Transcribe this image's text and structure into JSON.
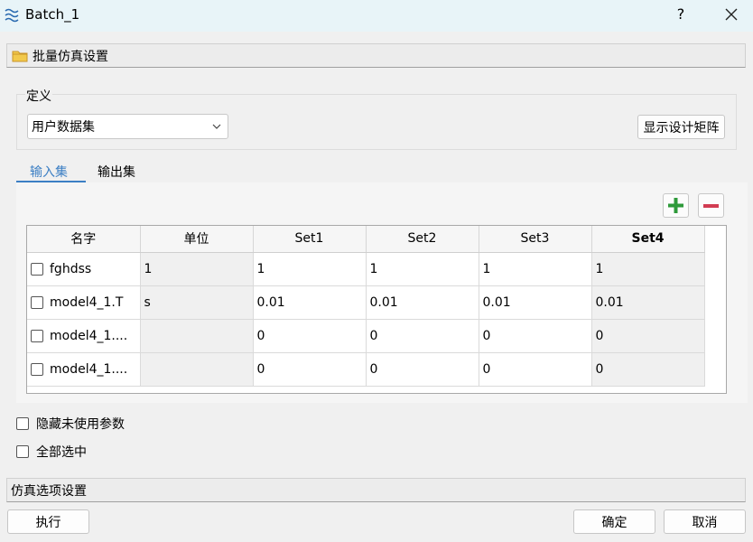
{
  "window": {
    "title": "Batch_1",
    "help": "?"
  },
  "batch_section": {
    "label": "批量仿真设置"
  },
  "definition": {
    "group_title": "定义",
    "dataset_select": {
      "value": "用户数据集"
    },
    "show_matrix_label": "显示设计矩阵"
  },
  "tabs": [
    {
      "label": "输入集"
    },
    {
      "label": "输出集"
    }
  ],
  "table": {
    "headers": [
      "名字",
      "单位",
      "Set1",
      "Set2",
      "Set3",
      "Set4"
    ],
    "rows": [
      {
        "name": "fghdss",
        "unit": "1",
        "values": [
          "1",
          "1",
          "1",
          "1"
        ]
      },
      {
        "name": "model4_1.T",
        "unit": "s",
        "values": [
          "0.01",
          "0.01",
          "0.01",
          "0.01"
        ]
      },
      {
        "name": "model4_1....",
        "unit": "",
        "values": [
          "0",
          "0",
          "0",
          "0"
        ]
      },
      {
        "name": "model4_1....",
        "unit": "",
        "values": [
          "0",
          "0",
          "0",
          "0"
        ]
      }
    ]
  },
  "options": {
    "hide_unused": "隐藏未使用参数",
    "select_all": "全部选中"
  },
  "sim_section": {
    "label": "仿真选项设置"
  },
  "buttons": {
    "run": "执行",
    "ok": "确定",
    "cancel": "取消"
  },
  "colors": {
    "add": "#2e9a3a",
    "remove": "#d23c52",
    "tab_accent": "#3c7fc4",
    "titlebar": "#e8f4f8"
  }
}
